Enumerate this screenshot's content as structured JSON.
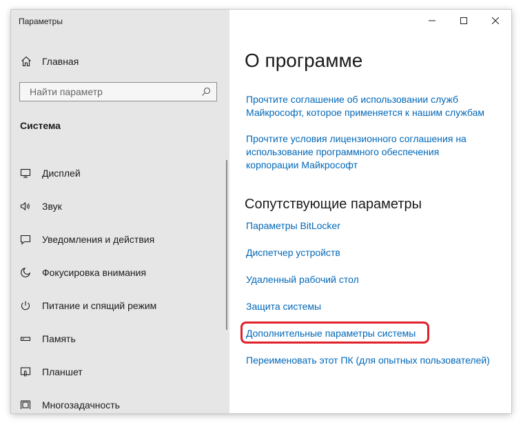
{
  "window": {
    "title": "Параметры",
    "controls": {
      "minimize": "—",
      "maximize": "☐",
      "close": "✕"
    }
  },
  "sidebar": {
    "home_label": "Главная",
    "search_placeholder": "Найти параметр",
    "section_title": "Система",
    "items": [
      {
        "label": "Дисплей",
        "icon": "display-icon"
      },
      {
        "label": "Звук",
        "icon": "speaker-icon"
      },
      {
        "label": "Уведомления и действия",
        "icon": "notification-icon"
      },
      {
        "label": "Фокусировка внимания",
        "icon": "moon-icon"
      },
      {
        "label": "Питание и спящий режим",
        "icon": "power-icon"
      },
      {
        "label": "Память",
        "icon": "storage-icon"
      },
      {
        "label": "Планшет",
        "icon": "tablet-icon"
      },
      {
        "label": "Многозадачность",
        "icon": "multitasking-icon"
      }
    ]
  },
  "main": {
    "title": "О программе",
    "agreement_links": [
      {
        "line1": "Прочтите соглашение об использовании служб",
        "line2": "Майкрософт, которое применяется к нашим службам"
      },
      {
        "line1": "Прочтите условия лицензионного соглашения на",
        "line2": "использование программного обеспечения",
        "line3": "корпорации Майкрософт"
      }
    ],
    "related_heading": "Сопутствующие параметры",
    "related_links": [
      "Параметры BitLocker",
      "Диспетчер устройств",
      "Удаленный рабочий стол",
      "Защита системы",
      "Дополнительные параметры системы",
      "Переименовать этот ПК (для опытных пользователей)"
    ]
  },
  "colors": {
    "link": "#0067b8",
    "sidebar_bg": "#e6e6e6",
    "highlight": "#e0202a"
  }
}
